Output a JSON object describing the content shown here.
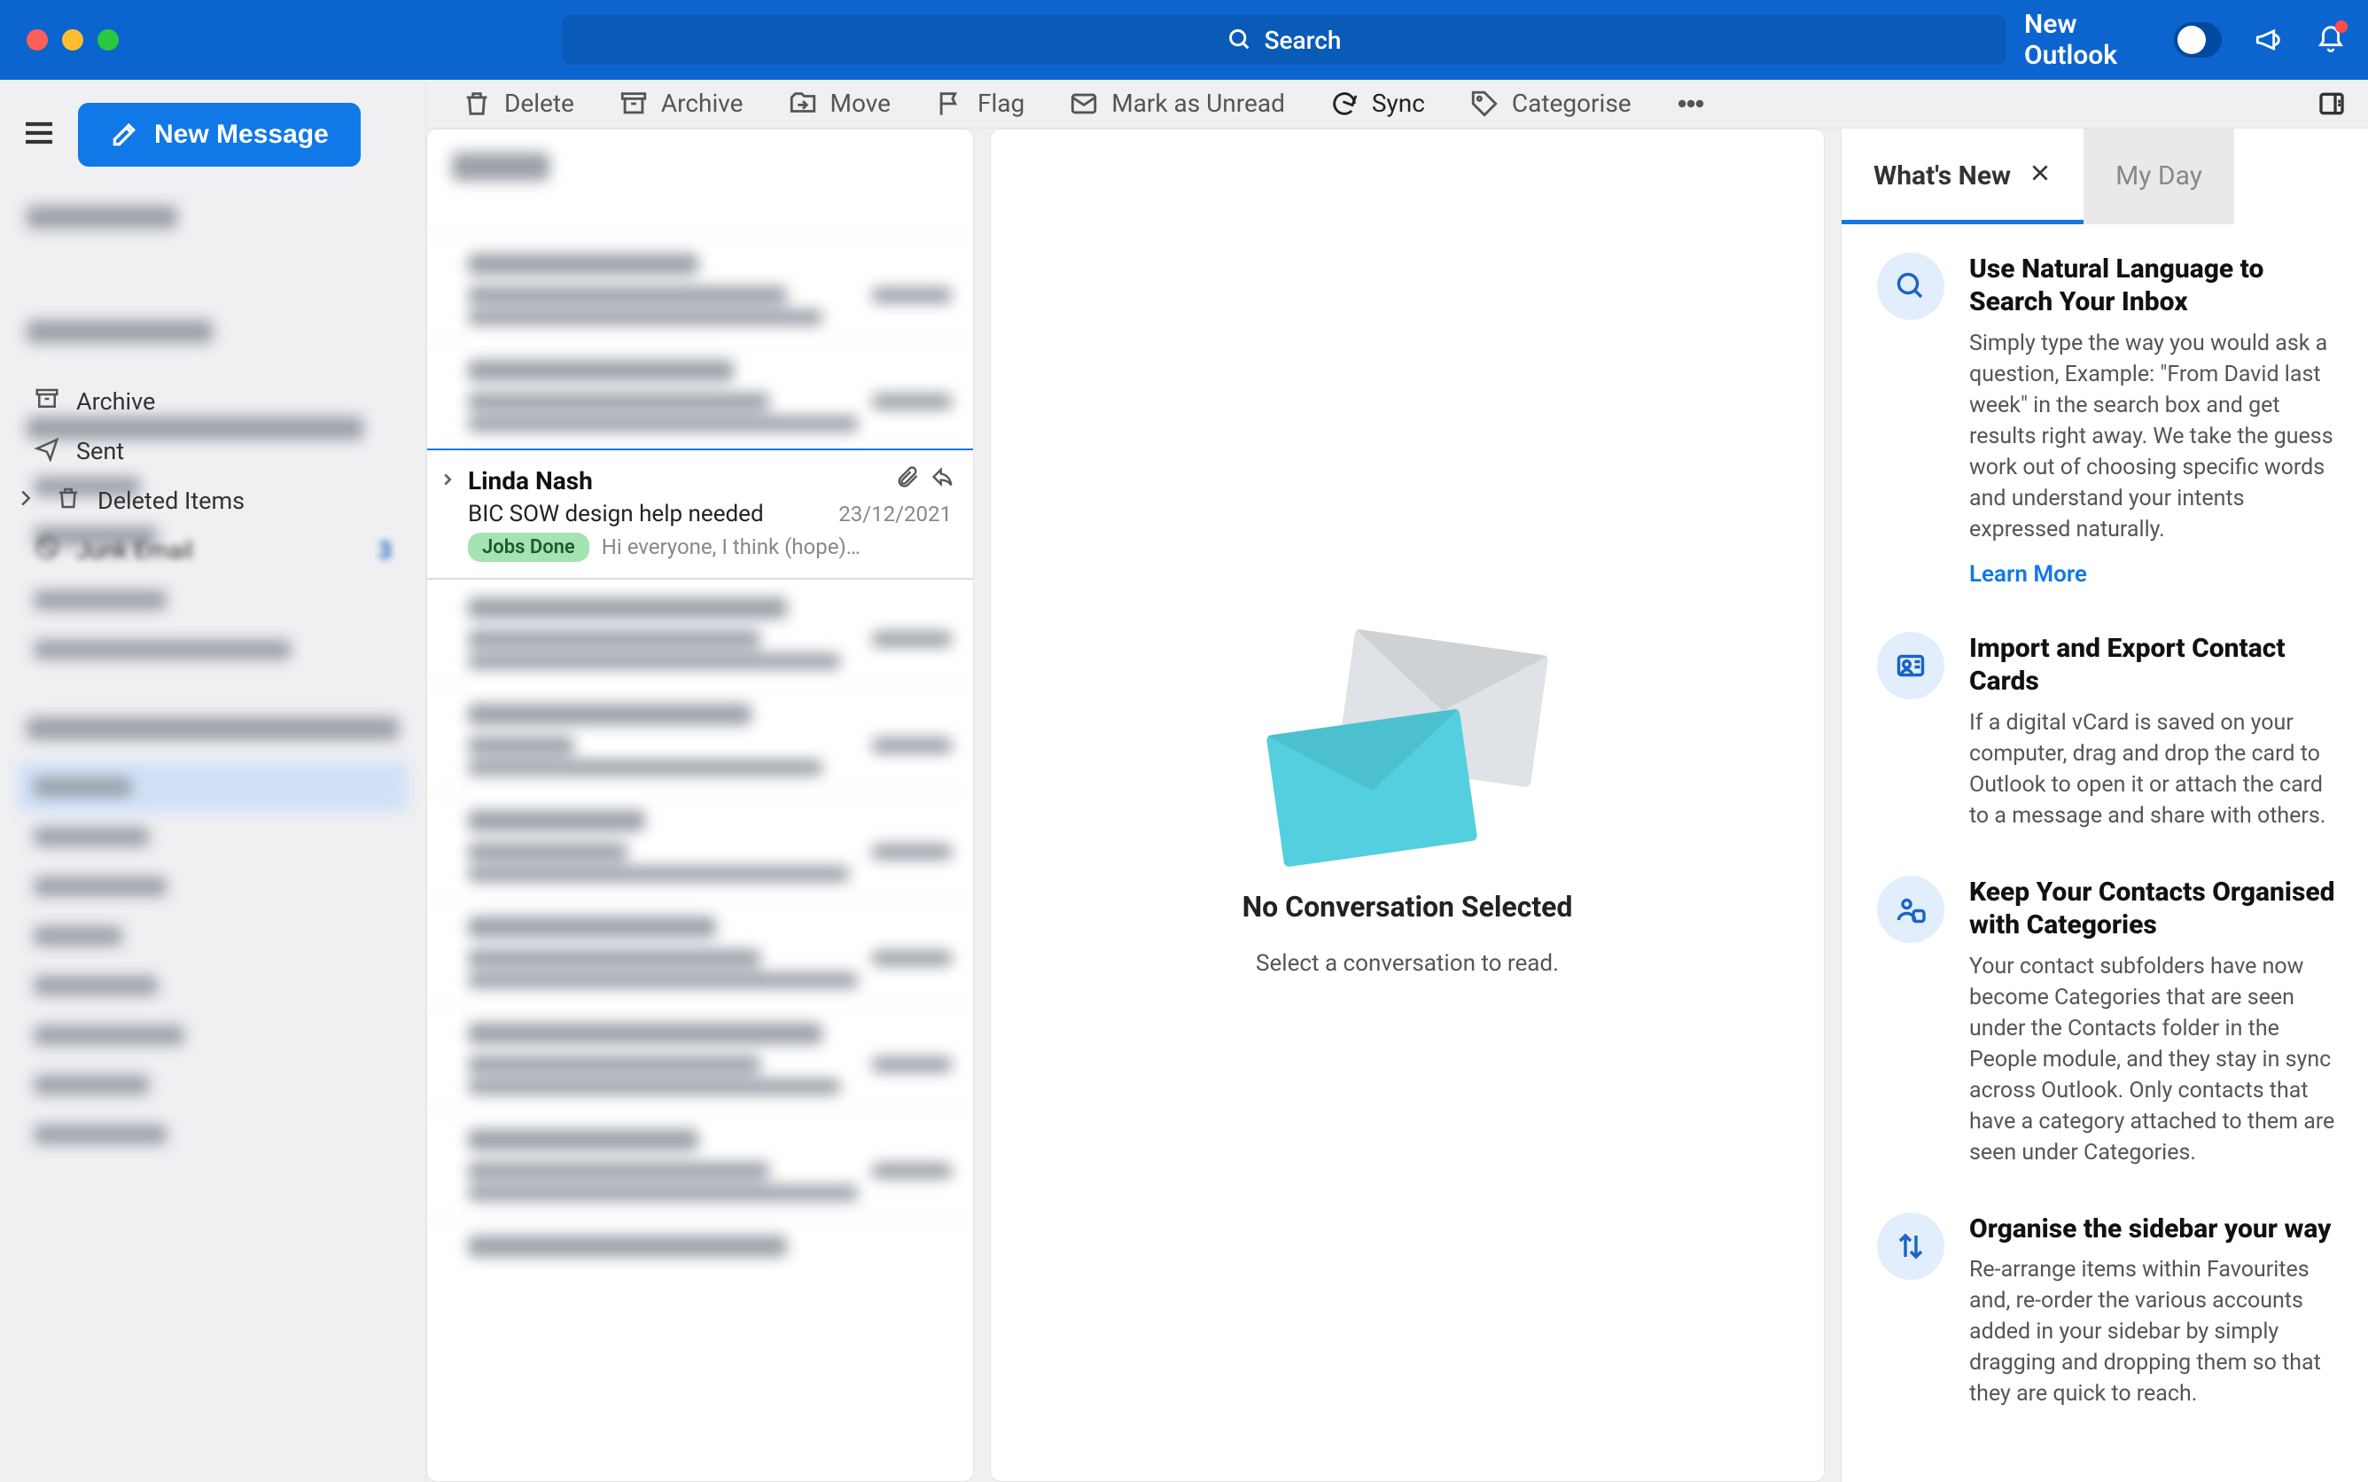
{
  "titlebar": {
    "search_placeholder": "Search",
    "new_outlook": "New Outlook"
  },
  "new_message": "New Message",
  "toolbar": {
    "delete": "Delete",
    "archive": "Archive",
    "move": "Move",
    "flag": "Flag",
    "mark_unread": "Mark as Unread",
    "sync": "Sync",
    "categorise": "Categorise"
  },
  "sidebar": {
    "archive": "Archive",
    "sent": "Sent",
    "deleted": "Deleted Items",
    "junk": "Junk Email",
    "junk_count": "3"
  },
  "message": {
    "from": "Linda Nash",
    "subject": "BIC SOW design help needed",
    "date": "23/12/2021",
    "tag": "Jobs Done",
    "preview": "Hi everyone, I think (hope)…"
  },
  "reading": {
    "title": "No Conversation Selected",
    "subtitle": "Select a conversation to read."
  },
  "rightpanel": {
    "tabs": {
      "whats_new": "What's New",
      "my_day": "My Day"
    },
    "items": [
      {
        "title": "Use Natural Language to Search Your Inbox",
        "body": "Simply type the way you would ask a question, Example: \"From David last week\" in the search box and get results right away. We take the guess work out of choosing specific words and understand your intents expressed naturally.",
        "link": "Learn More"
      },
      {
        "title": "Import and Export Contact Cards",
        "body": "If a digital vCard is saved on your computer, drag and drop the card to Outlook to open it or attach the card to a message and share with others."
      },
      {
        "title": "Keep Your Contacts Organised with Categories",
        "body": "Your contact subfolders have now become Categories that are seen under the Contacts folder in the People module, and they stay in sync across Outlook. Only contacts that have a category attached to them are seen under Categories."
      },
      {
        "title": "Organise the sidebar your way",
        "body": "Re-arrange items within Favourites and, re-order the various accounts added in your sidebar by simply dragging and dropping them so that they are quick to reach."
      }
    ]
  }
}
